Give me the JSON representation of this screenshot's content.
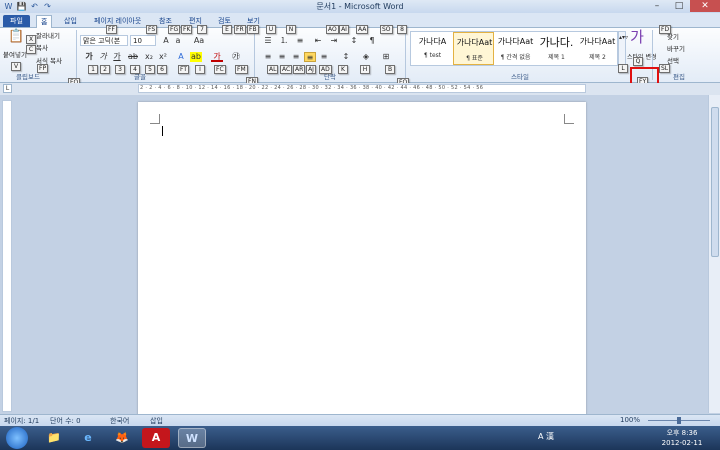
{
  "window": {
    "title": "문서1 - Microsoft Word",
    "minimize": "–",
    "maximize": "□",
    "close": "✕"
  },
  "quick_access": [
    "W",
    "💾",
    "↶",
    "↷"
  ],
  "tabs": {
    "file": "파일",
    "home": "홈",
    "insert": "삽입",
    "page_layout": "페이지 레이아웃",
    "references": "참조",
    "mailings": "편지",
    "review": "검토",
    "view": "보기"
  },
  "clipboard": {
    "paste": "붙여넣기",
    "cut": "잘라내기",
    "copy": "복사",
    "format_painter": "서식 복사",
    "label": "클립보드"
  },
  "font": {
    "name": "맑은 고딕(본",
    "size": "10",
    "label": "글꼴"
  },
  "paragraph": {
    "label": "단락"
  },
  "styles": {
    "label": "스타일",
    "items": [
      {
        "sample": "가나다A",
        "name": "¶ test"
      },
      {
        "sample": "가나다Aat",
        "name": "¶ 표준"
      },
      {
        "sample": "가나다Aat",
        "name": "¶ 간격 없음"
      },
      {
        "sample": "가나다.",
        "name": "제목 1"
      },
      {
        "sample": "가나다Aat",
        "name": "제목 2"
      }
    ],
    "change_styles": "스타일 변경"
  },
  "editing": {
    "find": "찾기",
    "replace": "바꾸기",
    "select": "선택",
    "label": "편집"
  },
  "keytips": {
    "ff": "FF",
    "fs": "FS",
    "fg": "FG",
    "fk": "FK",
    "seven": "7",
    "e": "E",
    "fr": "FR",
    "fb": "FB",
    "u": "U",
    "n": "N",
    "ao": "AO",
    "ai": "AI",
    "aa": "AA",
    "so": "SO",
    "eight": "8",
    "fd": "FD",
    "x": "X",
    "c": "C",
    "fp": "FP",
    "v": "V",
    "one": "1",
    "two": "2",
    "three": "3",
    "four": "4",
    "five": "5",
    "six": "6",
    "ft": "FT",
    "i": "I",
    "fc": "FC",
    "fm": "FM",
    "fn": "FN",
    "al": "AL",
    "ac": "AC",
    "ar": "AR",
    "aj": "AJ",
    "ad": "AD",
    "k": "K",
    "h": "H",
    "b": "B",
    "l": "L",
    "q": "Q",
    "sl": "SL",
    "fo": "FO",
    "fy": "FY",
    "fq": "FQ"
  },
  "ruler": {
    "numbers": "2 · 2 · 4 · 6 · 8 · 10 · 12 · 14 · 16 · 18 · 20 · 22 · 24 · 26 · 28 · 30 · 32 · 34 · 36 · 38 · 40 · 42 · 44 · 46 · 48 · 50 · 52 · 54 · 56"
  },
  "status": {
    "page": "페이지: 1/1",
    "words": "단어 수: 0",
    "language": "한국어",
    "mode": "삽입",
    "zoom": "100%"
  },
  "taskbar": {
    "apps": [
      "📁",
      "e",
      "🦊",
      "A",
      "W"
    ],
    "ime": "A 漢",
    "time": "오후 8:36",
    "date": "2012-02-11"
  }
}
